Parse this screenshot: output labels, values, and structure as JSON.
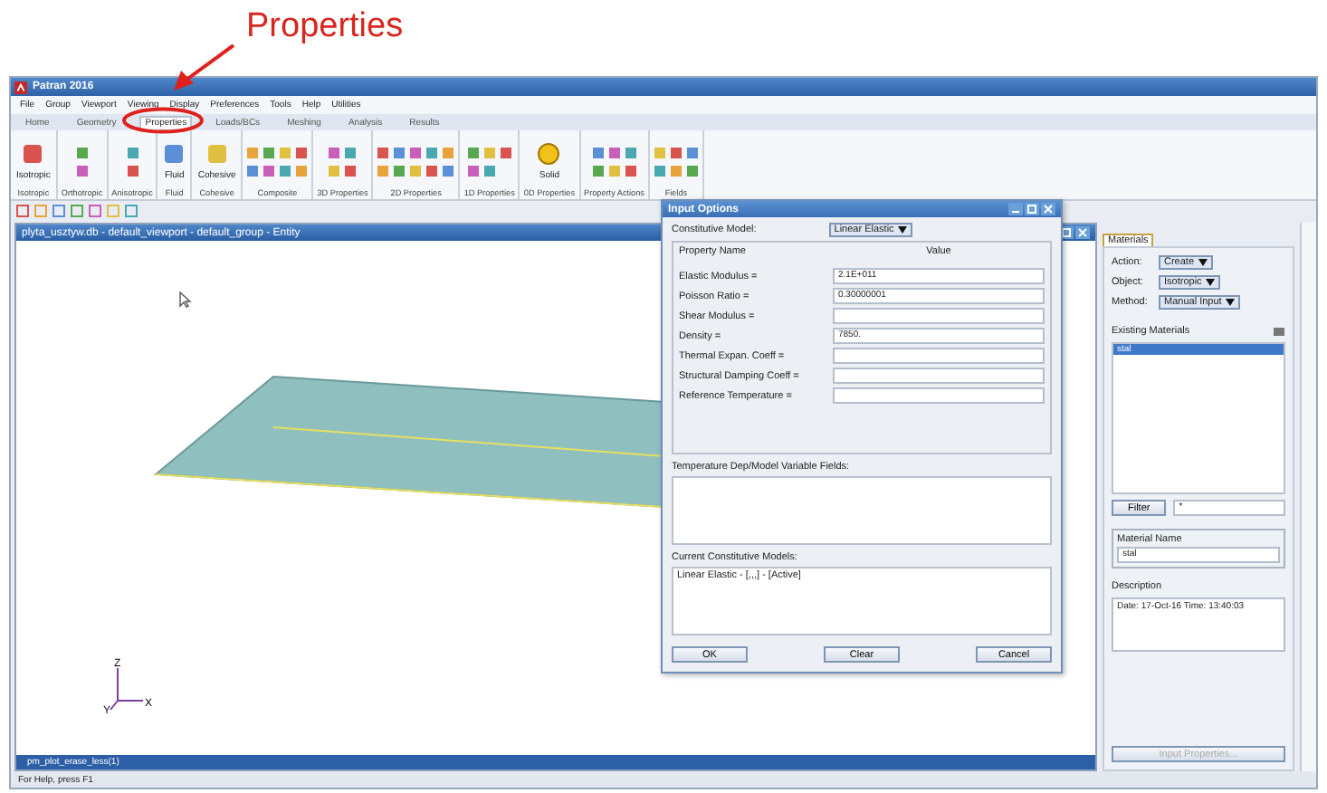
{
  "annotation": {
    "label": "Properties"
  },
  "window": {
    "title": "Patran 2016"
  },
  "menu": [
    "File",
    "Group",
    "Viewport",
    "Viewing",
    "Display",
    "Preferences",
    "Tools",
    "Help",
    "Utilities"
  ],
  "ribbon_tabs": [
    {
      "label": "Home",
      "selected": false
    },
    {
      "label": "Geometry",
      "selected": false
    },
    {
      "label": "Properties",
      "selected": true
    },
    {
      "label": "Loads/BCs",
      "selected": false
    },
    {
      "label": "Meshing",
      "selected": false
    },
    {
      "label": "Analysis",
      "selected": false
    },
    {
      "label": "Results",
      "selected": false
    }
  ],
  "ribbon_groups": [
    {
      "label": "Isotropic",
      "button": "Isotropic"
    },
    {
      "label": "Orthotropic"
    },
    {
      "label": "Anisotropic"
    },
    {
      "label": "Fluid",
      "button": "Fluid"
    },
    {
      "label": "Cohesive",
      "button": "Cohesive"
    },
    {
      "label": "Composite"
    },
    {
      "label": "3D Properties"
    },
    {
      "label": "2D Properties"
    },
    {
      "label": "1D Properties"
    },
    {
      "label": "0D Properties",
      "button": "Solid"
    },
    {
      "label": "Property Actions"
    },
    {
      "label": "Fields"
    }
  ],
  "viewport": {
    "title": "plyta_usztyw.db - default_viewport - default_group - Entity",
    "axes": [
      "Z",
      "Y",
      "X"
    ]
  },
  "dialog": {
    "title": "Input Options",
    "model_label": "Constitutive Model:",
    "model": "Linear Elastic",
    "columns": [
      "Property Name",
      "Value"
    ],
    "properties": [
      {
        "name": "Elastic Modulus =",
        "value": "2.1E+011"
      },
      {
        "name": "Poisson Ratio =",
        "value": "0.30000001"
      },
      {
        "name": "Shear Modulus ="
      },
      {
        "name": "Density =",
        "value": "7850."
      },
      {
        "name": "Thermal Expan. Coeff ="
      },
      {
        "name": "Structural Damping Coeff ="
      },
      {
        "name": "Reference Temperature ="
      }
    ],
    "fields_label": "Temperature Dep/Model Variable Fields:",
    "models_label": "Current Constitutive Models:",
    "models": [
      "Linear Elastic - [,,,] - [Active]"
    ],
    "buttons": [
      "OK",
      "Clear",
      "Cancel"
    ]
  },
  "panel": {
    "tab": "Materials",
    "action_label": "Action:",
    "action": "Create",
    "object_label": "Object:",
    "object": "Isotropic",
    "method_label": "Method:",
    "method": "Manual Input",
    "existing_label": "Existing Materials",
    "materials": [
      {
        "name": "stal",
        "selected": true
      }
    ],
    "filter_button": "Filter",
    "filter": "*",
    "name_label": "Material Name",
    "name": "stal",
    "description_label": "Description",
    "description": "Date: 17-Oct-16        Time: 13:40:03",
    "input_button": {
      "label": "Input Properties...",
      "disabled": true
    }
  },
  "command_line": "pm_plot_erase_less(1)",
  "status_bar": "For Help, press F1"
}
